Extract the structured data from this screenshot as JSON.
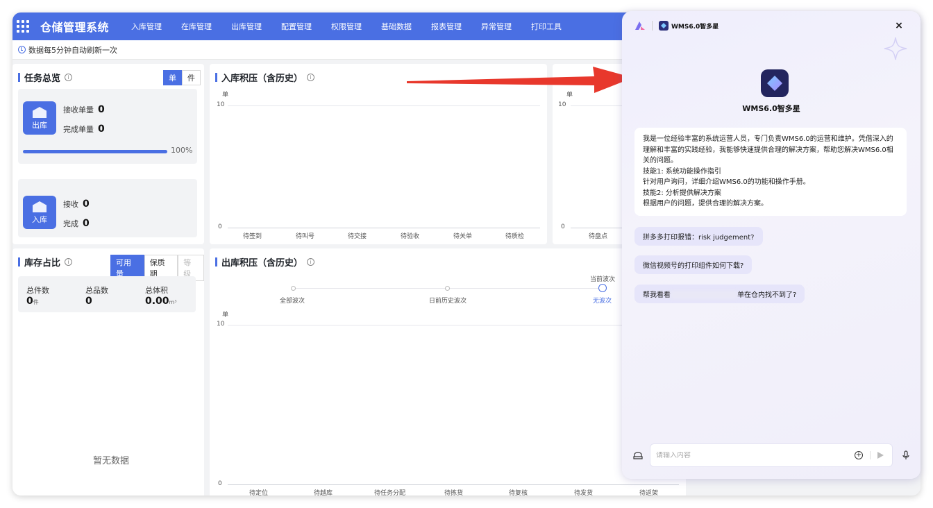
{
  "app": {
    "title": "仓储管理系统",
    "nav": [
      "入库管理",
      "在库管理",
      "出库管理",
      "配置管理",
      "权限管理",
      "基础数据",
      "报表管理",
      "异常管理",
      "打印工具"
    ],
    "accent": "#4a6fe3"
  },
  "refresh": {
    "text": "数据每5分钟自动刷新一次"
  },
  "task_overview": {
    "title": "任务总览",
    "toggle": [
      "单",
      "件"
    ],
    "outbound": {
      "icon_label": "出库",
      "received_label": "接收单量",
      "received_value": "0",
      "completed_label": "完成单量",
      "completed_value": "0",
      "progress_label": "100%",
      "progress_fraction": 1.0
    },
    "inbound": {
      "icon_label": "入库",
      "received_label": "接收",
      "received_value": "0",
      "completed_label": "完成",
      "completed_value": "0"
    }
  },
  "inventory": {
    "title": "库存占比",
    "toggle": [
      "可用量",
      "保质期",
      "等级"
    ],
    "stats": [
      {
        "label": "总件数",
        "value": "0",
        "unit": "件"
      },
      {
        "label": "总品数",
        "value": "0",
        "unit": ""
      },
      {
        "label": "总体积",
        "value": "0.00",
        "unit": "m³"
      }
    ],
    "empty": "暂无数据"
  },
  "inbound_backlog": {
    "title": "入库积压（含历史）",
    "unit": "单",
    "y_ticks": [
      "10",
      "0"
    ],
    "categories": [
      "待签到",
      "待叫号",
      "待交接",
      "待验收",
      "待关单",
      "待质检"
    ]
  },
  "onhand_backlog": {
    "unit": "单",
    "y_ticks": [
      "10",
      "0"
    ],
    "categories": [
      "待盘点"
    ]
  },
  "outbound_backlog": {
    "title": "出库积压（含历史）",
    "waves": [
      "全部波次",
      "日前历史波次",
      "无波次"
    ],
    "current_wave_label": "当前波次",
    "unit": "单",
    "y_ticks": [
      "10",
      "0"
    ],
    "categories": [
      "待定位",
      "待越库",
      "待任务分配",
      "待拣货",
      "待复核",
      "待发货",
      "待返架"
    ]
  },
  "chat": {
    "header_name": "WMS6.0智多星",
    "name": "WMS6.0智多星",
    "intro": [
      "我是一位经验丰富的系统运营人员，专门负责WMS6.0的运营和维护。凭借深入的理解和丰富的实践经验，我能够快速提供合理的解决方案，帮助您解决WMS6.0相关的问题。",
      "技能1: 系统功能操作指引",
      "针对用户询问，详细介绍WMS6.0的功能和操作手册。",
      "技能2: 分析提供解决方案",
      "根据用户的问题，提供合理的解决方案。"
    ],
    "suggestions": [
      "拼多多打印报错：risk judgement?",
      "微信视频号的打印组件如何下载?"
    ],
    "suggestion3_prefix": "帮我看看",
    "suggestion3_suffix": "单在仓内找不到了?",
    "input_placeholder": "请输入内容",
    "close": "×"
  }
}
